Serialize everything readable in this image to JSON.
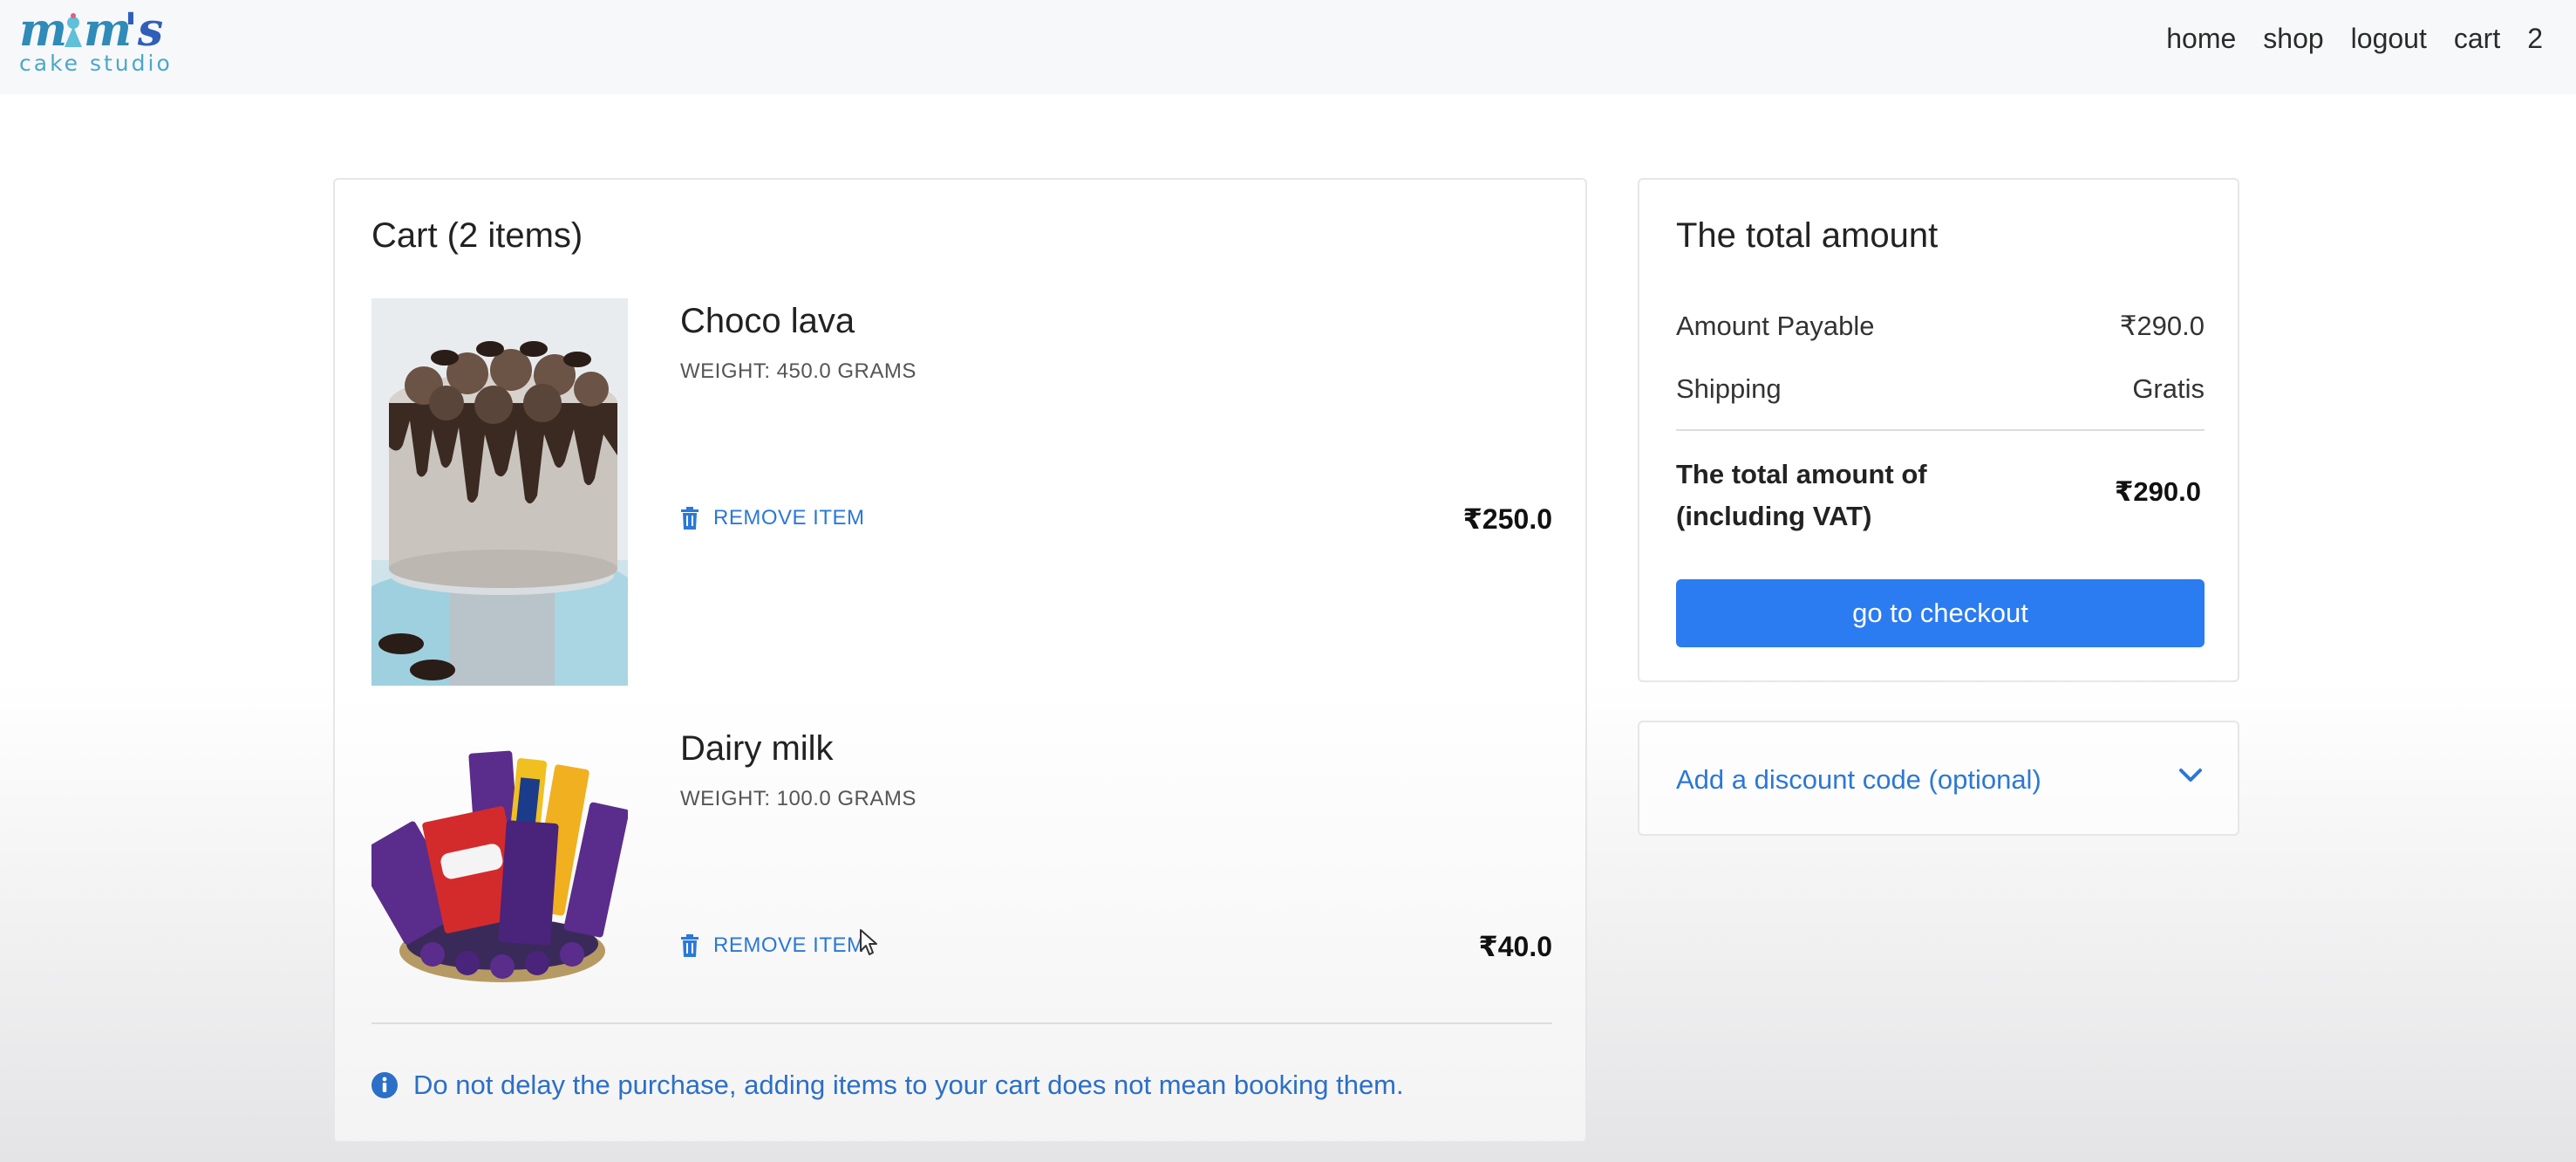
{
  "brand": {
    "logo_text": "mom's",
    "logo_subtitle": "cake studio"
  },
  "nav": {
    "items": [
      "home",
      "shop",
      "logout",
      "cart",
      "2"
    ]
  },
  "cart": {
    "title": "Cart (2 items)",
    "items": [
      {
        "name": "Choco lava",
        "weight": "WEIGHT: 450.0 GRAMS",
        "remove_label": "REMOVE ITEM",
        "price": "₹250.0"
      },
      {
        "name": "Dairy milk",
        "weight": "WEIGHT: 100.0 GRAMS",
        "remove_label": "REMOVE ITEM",
        "price": "₹40.0"
      }
    ],
    "notice": "Do not delay the purchase, adding items to your cart does not mean booking them."
  },
  "summary": {
    "title": "The total amount",
    "amount_payable_label": "Amount Payable",
    "amount_payable_value": "₹290.0",
    "shipping_label": "Shipping",
    "shipping_value": "Gratis",
    "grand_label": "The total amount of (including VAT)",
    "grand_value": "₹290.0",
    "checkout_label": "go to checkout"
  },
  "discount": {
    "label": "Add a discount code (optional)"
  },
  "colors": {
    "accent": "#2b7bf1",
    "link": "#2b78d6",
    "navbar_bg": "#f7f8fa"
  }
}
